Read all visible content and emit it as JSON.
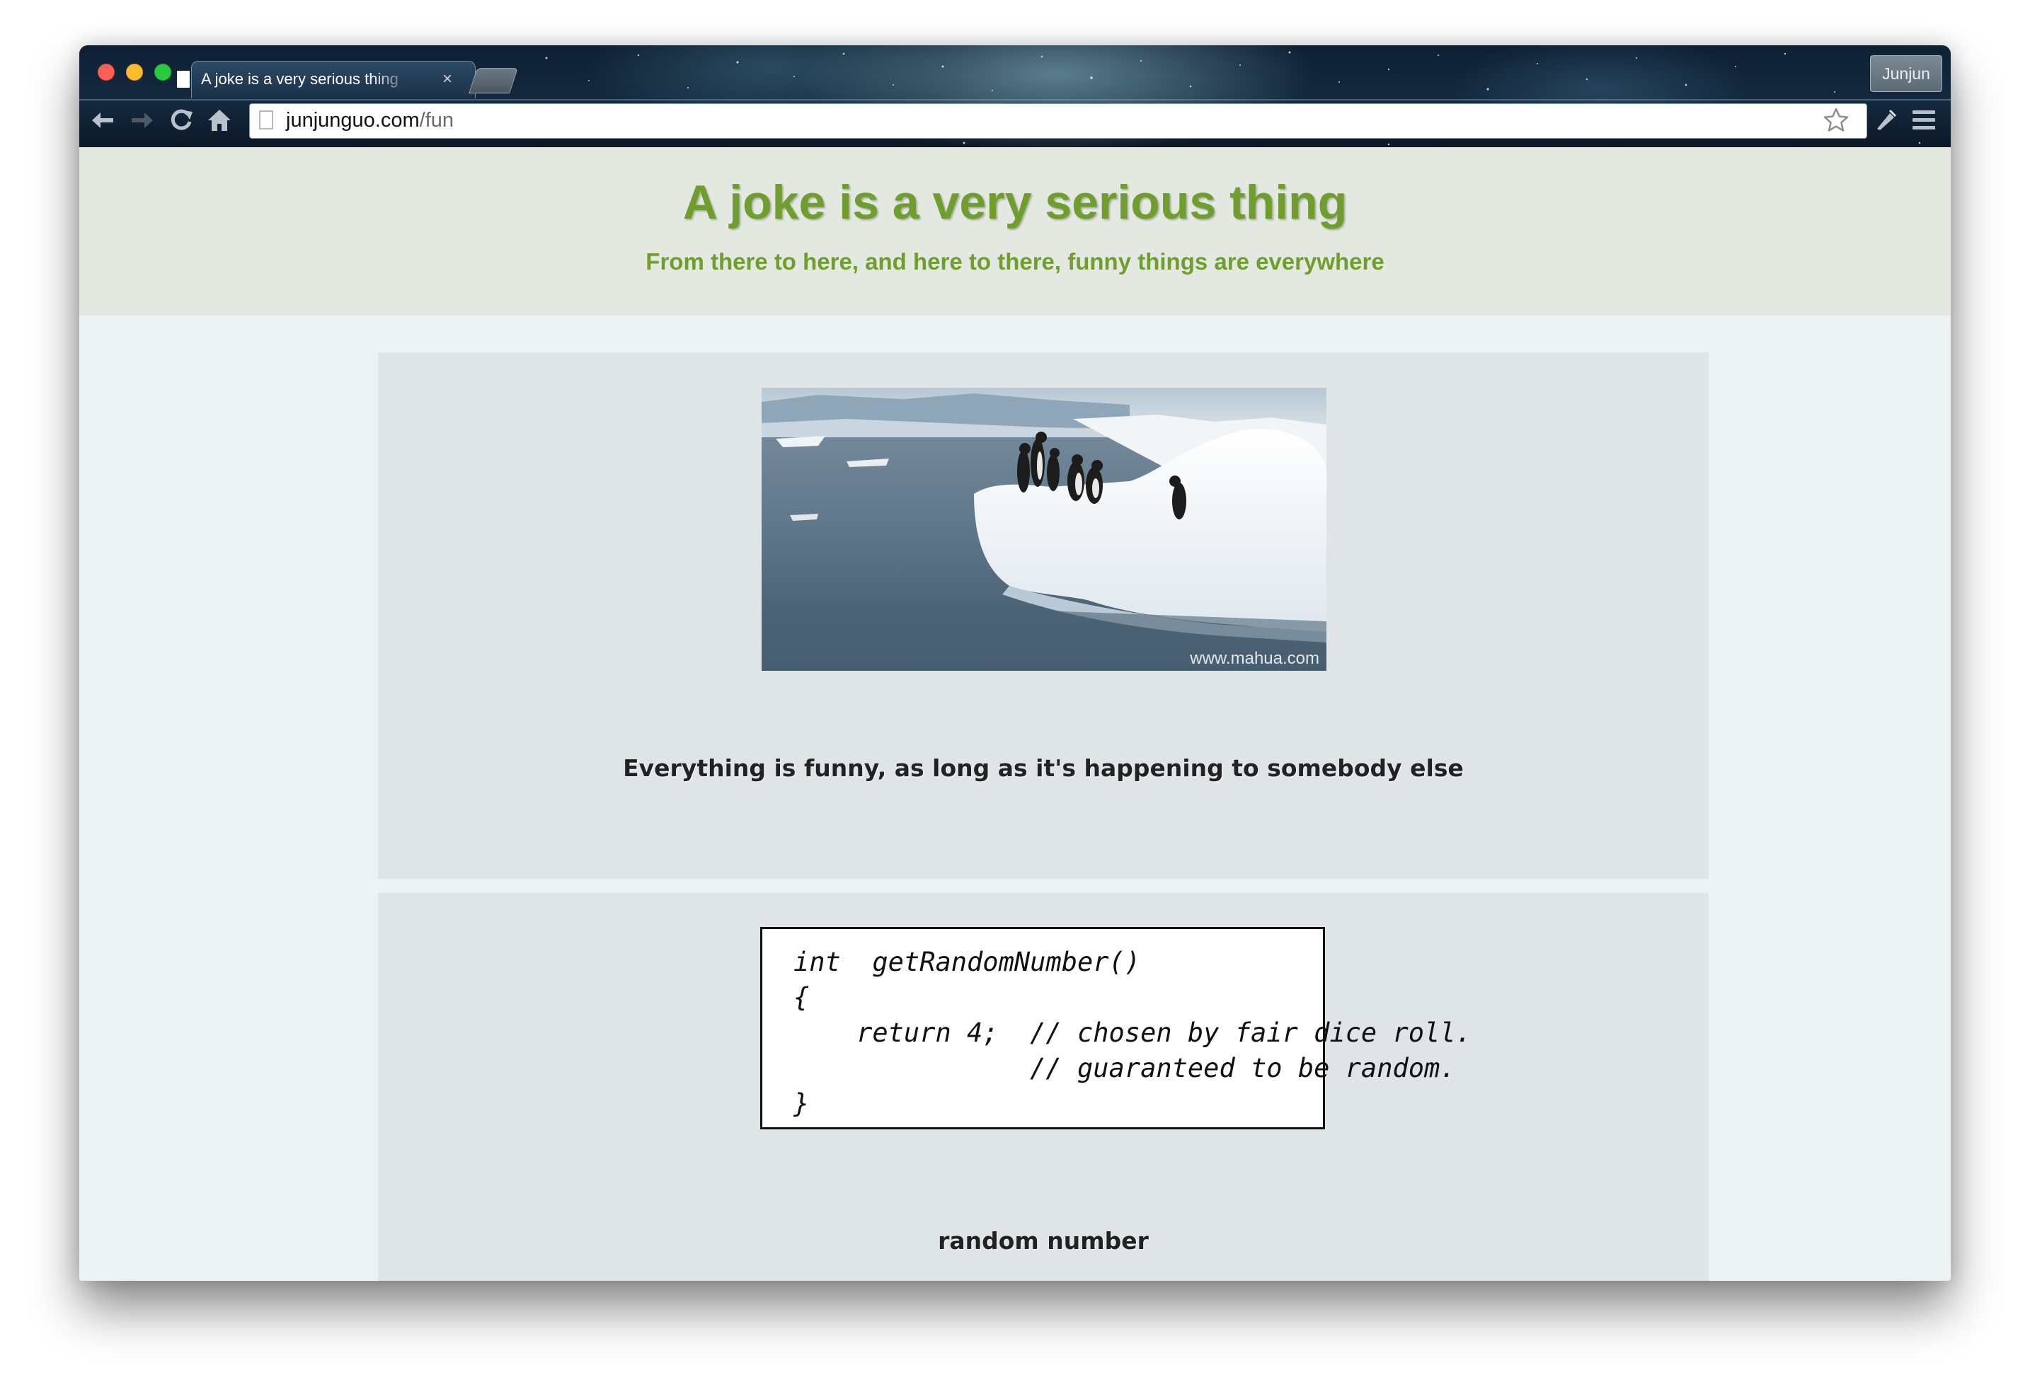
{
  "browser": {
    "tab_title": "A joke is a very serious thing",
    "tab_close": "×",
    "profile_name": "Junjun",
    "url_domain": "junjunguo.com",
    "url_path": "/fun"
  },
  "site": {
    "title": "A joke is a very serious thing",
    "subtitle": "From there to here, and here to there, funny things are everywhere"
  },
  "posts": [
    {
      "image_icon": "penguins-on-iceberg-image",
      "image_watermark": "www.mahua.com",
      "caption": "Everything is funny, as long as it's happening to somebody else"
    },
    {
      "image_icon": "xkcd-random-number-comic",
      "code_lines": [
        "int  getRandomNumber()",
        "{",
        "    return 4;  // chosen by fair dice roll.",
        "               // guaranteed to be random.",
        "}"
      ],
      "caption": "random number"
    }
  ]
}
